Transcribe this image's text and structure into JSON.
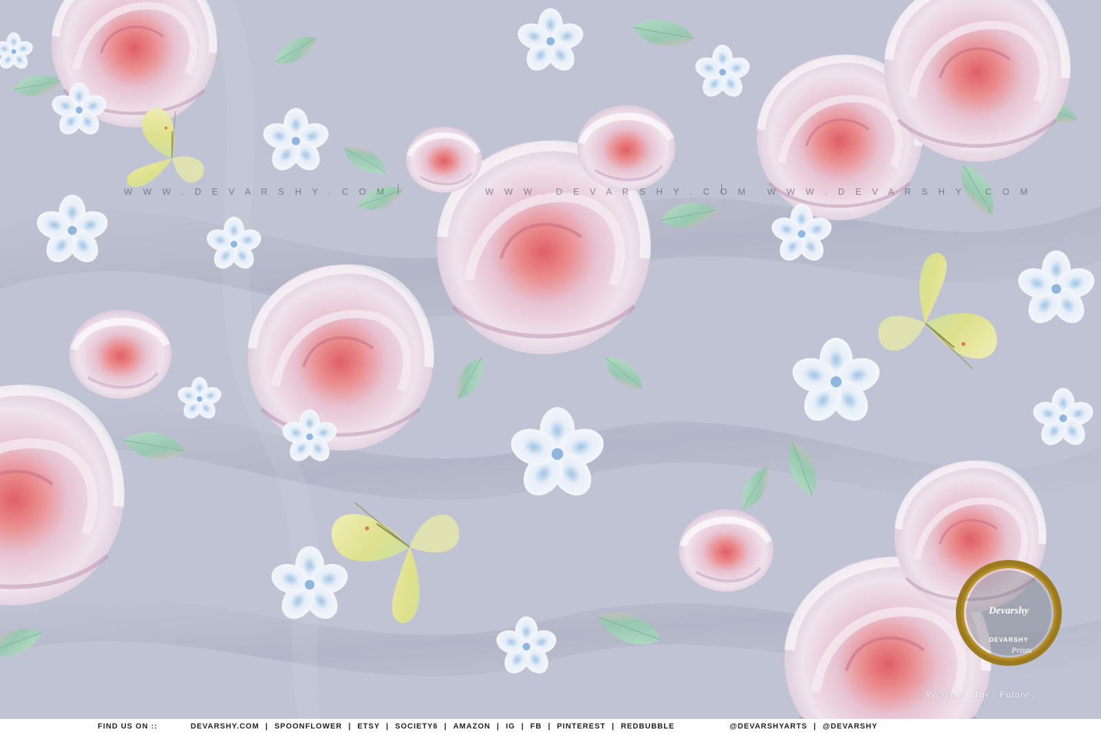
{
  "watermarks": [
    "W W W . D E V A R S H Y . C O M",
    "W W W . D E V A R S H Y . C O M",
    "W W W . D E V A R S H Y . C O M"
  ],
  "footer": {
    "find_us": "FIND US ON ::",
    "links": [
      "DEVARSHY.COM",
      "SPOONFLOWER",
      "ETSY",
      "SOCIETY6",
      "AMAZON",
      "IG",
      "FB",
      "PINTEREST",
      "REDBUBBLE"
    ],
    "handle_prefix": "@DEVARSHY",
    "handle_suffix": "ARTS",
    "handle2": "@DEVARSHY"
  },
  "logo": {
    "name": "Devarshy",
    "sub": "DEVARSHY",
    "prints": "Prints",
    "tagline": "Recreate . The . Future ."
  },
  "colors": {
    "fabric": "#bfc3d3",
    "rose": "#e7d3df",
    "rose_center": "#e26f73",
    "leaf": "#9fd0b5",
    "butterfly": "#e4e69a",
    "blossom": "#d9e6f5",
    "gold": "#c9a032",
    "handle_accent": "#c21a6e"
  }
}
